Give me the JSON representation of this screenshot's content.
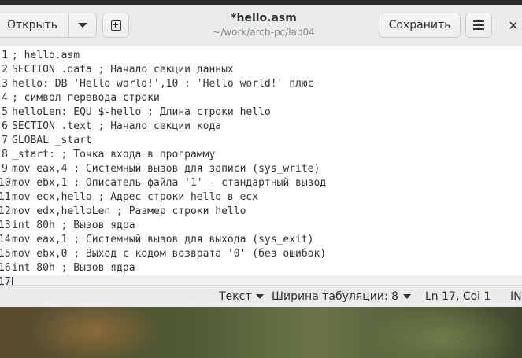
{
  "window": {
    "title": "*hello.asm",
    "subtitle": "~/work/arch-pc/lab04"
  },
  "header": {
    "open_label": "Открыть",
    "save_label": "Сохранить",
    "close_glyph": "✕"
  },
  "editor": {
    "lines": [
      {
        "num": "1",
        "text": "; hello.asm"
      },
      {
        "num": "2",
        "text": "SECTION .data ; Начало секции данных"
      },
      {
        "num": "3",
        "text": "hello: DB 'Hello world!',10 ; 'Hello world!' плюс"
      },
      {
        "num": "4",
        "text": "; символ перевода строки"
      },
      {
        "num": "5",
        "text": "helloLen: EQU $-hello ; Длина строки hello"
      },
      {
        "num": "6",
        "text": "SECTION .text ; Начало секции кода"
      },
      {
        "num": "7",
        "text": "GLOBAL _start"
      },
      {
        "num": "8",
        "text": "_start: ; Точка входа в программу"
      },
      {
        "num": "9",
        "text": "mov eax,4 ; Системный вызов для записи (sys_write)"
      },
      {
        "num": "10",
        "text": "mov ebx,1 ; Описатель файла '1' - стандартный вывод"
      },
      {
        "num": "11",
        "text": "mov ecx,hello ; Адрес строки hello в ecx"
      },
      {
        "num": "12",
        "text": "mov edx,helloLen ; Размер строки hello"
      },
      {
        "num": "13",
        "text": "int 80h ; Вызов ядра"
      },
      {
        "num": "14",
        "text": "mov eax,1 ; Системный вызов для выхода (sys_exit)"
      },
      {
        "num": "15",
        "text": "mov ebx,0 ; Выход с кодом возврата '0' (без ошибок)"
      },
      {
        "num": "16",
        "text": "int 80h ; Вызов ядра"
      },
      {
        "num": "17",
        "text": ""
      }
    ]
  },
  "status": {
    "language": "Текст",
    "tab_width": "Ширина табуляции: 8",
    "position": "Ln 17, Col 1",
    "mode": "INS"
  },
  "icons": {
    "open_dropdown": "chevron-down-icon",
    "new_tab": "new-tab-icon",
    "menu": "hamburger-menu-icon",
    "close": "close-icon"
  }
}
